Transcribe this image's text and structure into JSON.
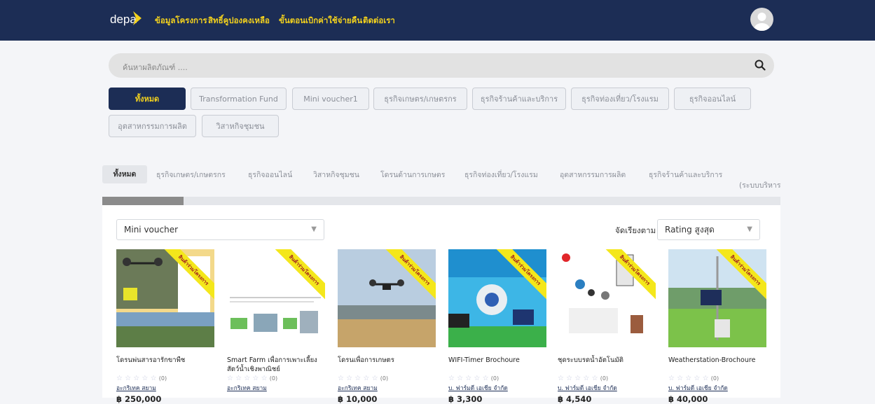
{
  "header": {
    "logo": "depa",
    "nav": [
      "ข้อมูลโครงการ",
      "สิทธิ์คูปองคงเหลือ",
      "ขั้นตอนเบิกค่าใช้จ่ายคืน",
      "ติดต่อเรา"
    ]
  },
  "search": {
    "placeholder": "ค้นหาผลิตภัณฑ์ ...."
  },
  "categories": [
    "ทั้งหมด",
    "Transformation Fund",
    "Mini voucher1",
    "ธุรกิจเกษตร/เกษตรกร",
    "ธุรกิจร้านค้าและบริการ",
    "ธุรกิจท่องเที่ยว/โรงแรม",
    "ธุรกิจออนไลน์",
    "อุตสาหกรรมการผลิต",
    "วิสาหกิจชุมชน"
  ],
  "tabs": [
    "ทั้งหมด",
    "ธุรกิจเกษตร/เกษตรกร",
    "ธุรกิจออนไลน์",
    "วิสาหกิจชุมชน",
    "โดรนด้านการเกษตร",
    "ธุรกิจท่องเที่ยว/โรงแรม",
    "อุตสาหกรรมการผลิต",
    "ธุรกิจร้านค้าและบริการ",
    "(ระบบบริหาร"
  ],
  "progress": {
    "fraction": 0.12
  },
  "filter": {
    "selected": "Mini voucher",
    "sort_label": "จัดเรียงตาม",
    "sort_selected": "Rating สูงสุด"
  },
  "ribbon": "สินค้าร่วมโครงการ",
  "products": [
    {
      "title": "โดรนพ่นสารอารักขาพืช",
      "rating": "☆ ☆ ☆ ☆ ☆",
      "count": "(0)",
      "seller": "อะกริเทค สยาม",
      "price": "฿ 250,000"
    },
    {
      "title": "Smart Farm เพื่อการเพาะเลี้ยงสัตว์น้ำเชิงพาณิชย์",
      "rating": "☆ ☆ ☆ ☆ ☆",
      "count": "(0)",
      "seller": "อะกริเทค สยาม",
      "price": ""
    },
    {
      "title": "โดรนเพื่อการเกษตร",
      "rating": "☆ ☆ ☆ ☆ ☆",
      "count": "(0)",
      "seller": "อะกริเทค สยาม",
      "price": "฿ 10,000"
    },
    {
      "title": "WIFI-Timer Brochoure",
      "rating": "☆ ☆ ☆ ☆ ☆",
      "count": "(0)",
      "seller": "บ. ฟาร์มดี เอเชีย จำกัด",
      "price": "฿ 3,300"
    },
    {
      "title": "ชุดระบบรดน้ำอัตโนมัติ",
      "rating": "☆ ☆ ☆ ☆ ☆",
      "count": "(0)",
      "seller": "บ. ฟาร์มดี เอเชีย จำกัด",
      "price": "฿ 4,540"
    },
    {
      "title": "Weatherstation-Brochoure",
      "rating": "☆ ☆ ☆ ☆ ☆",
      "count": "(0)",
      "seller": "บ. ฟาร์มดี เอเชีย จำกัด",
      "price": "฿ 40,000"
    }
  ],
  "colors": {
    "navy": "#1c2d55",
    "gold": "#f4d21d"
  }
}
